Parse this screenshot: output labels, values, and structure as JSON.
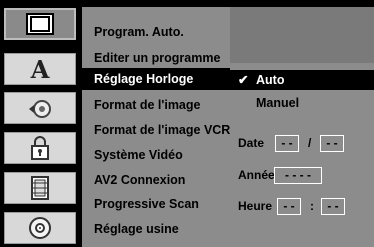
{
  "sidebar": {
    "icons": [
      {
        "name": "tv-screen-icon",
        "selected": true
      },
      {
        "name": "language-icon",
        "selected": false
      },
      {
        "name": "audio-icon",
        "selected": false
      },
      {
        "name": "lock-icon",
        "selected": false
      },
      {
        "name": "film-icon",
        "selected": false
      },
      {
        "name": "disc-icon",
        "selected": false
      }
    ]
  },
  "menu": {
    "items": [
      "Program. Auto.",
      "Editer un programme",
      "Réglage Horloge",
      "Format de l'image",
      "Format de l'image VCR",
      "Système Vidéo",
      "AV2 Connexion",
      "Progressive Scan",
      "Réglage usine"
    ],
    "selected_index": 2
  },
  "options": {
    "auto_check": "✔",
    "auto": "Auto",
    "manuel": "Manuel",
    "date_label": "Date",
    "date_day": "- -",
    "date_sep": "/",
    "date_month": "- -",
    "annee_label": "Année",
    "annee_value": "- - - -",
    "heure_label": "Heure",
    "heure_hours": "- -",
    "heure_sep": ":",
    "heure_minutes": "- -"
  },
  "colors": {
    "panel": "#8c8c8c",
    "highlight": "#000000",
    "highlight_text": "#ffffff"
  }
}
